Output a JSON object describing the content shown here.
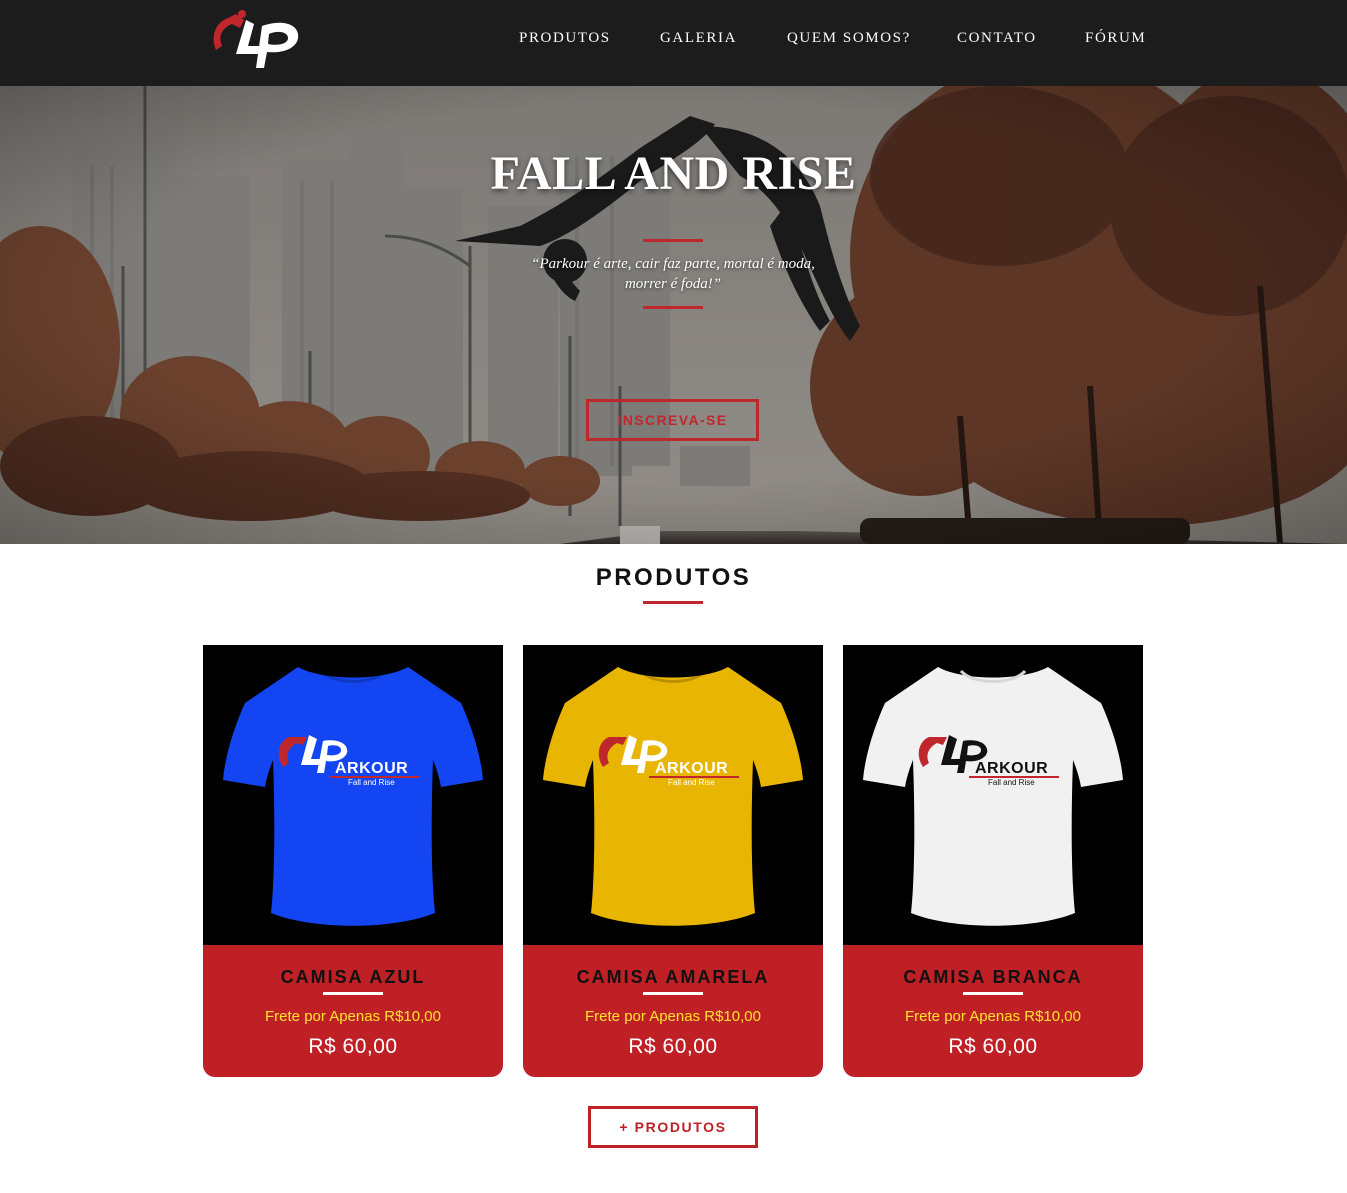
{
  "nav": {
    "logo_text": "LP",
    "items": [
      {
        "label": "PRODUTOS"
      },
      {
        "label": "GALERIA"
      },
      {
        "label": "QUEM SOMOS?"
      },
      {
        "label": "CONTATO"
      },
      {
        "label": "FÓRUM"
      }
    ]
  },
  "hero": {
    "title": "FALL AND RISE",
    "quote": "“Parkour é arte, cair faz parte, mortal é moda, morrer é foda!”",
    "cta_label": "INSCREVA-SE"
  },
  "products": {
    "title": "PRODUTOS",
    "items": [
      {
        "name": "CAMISA AZUL",
        "shipping": "Frete por Apenas R$10,00",
        "price": "R$ 60,00",
        "shirt_color": "#1346f2",
        "print_text": "ARKOUR",
        "print_sub": "Fall and Rise"
      },
      {
        "name": "CAMISA AMARELA",
        "shipping": "Frete por Apenas R$10,00",
        "price": "R$ 60,00",
        "shirt_color": "#e9b503",
        "print_text": "ARKOUR",
        "print_sub": "Fall and Rise"
      },
      {
        "name": "CAMISA BRANCA",
        "shipping": "Frete por Apenas R$10,00",
        "price": "R$ 60,00",
        "shirt_color": "#f1f1f1",
        "print_text": "ARKOUR",
        "print_sub": "Fall and Rise"
      }
    ],
    "more_label": "+ PRODUTOS"
  },
  "colors": {
    "navbar_bg": "#1c1c1c",
    "accent_red": "#be2025",
    "price_yellow": "#ffe22a"
  }
}
